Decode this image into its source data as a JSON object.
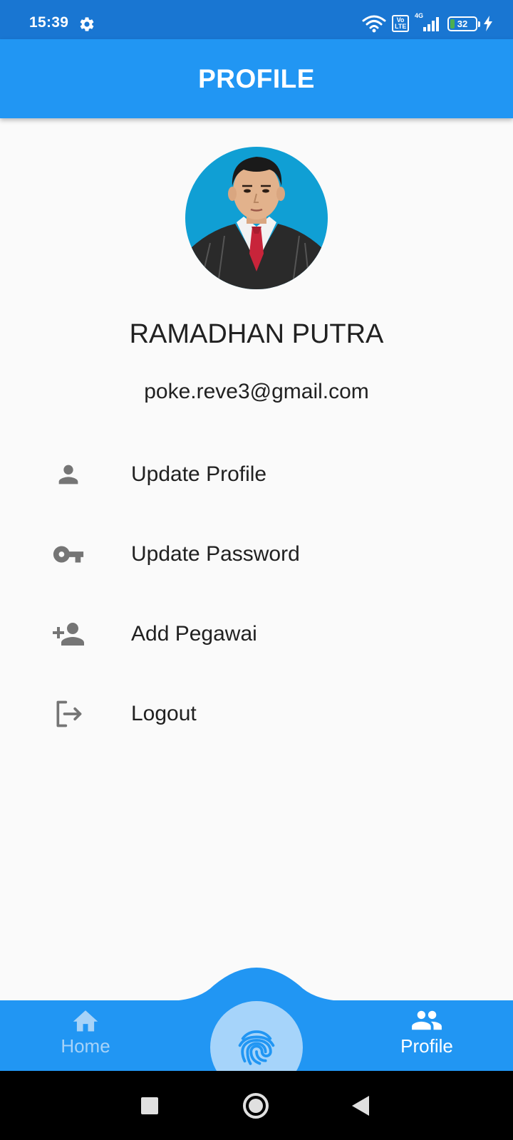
{
  "status_bar": {
    "time": "15:39",
    "network": "4G",
    "volte_top": "Vo",
    "volte_bottom": "LTE",
    "battery_level": "32",
    "icons": [
      "gear-icon",
      "wifi-icon",
      "volte-icon",
      "signal-icon",
      "battery-icon",
      "charging-icon"
    ]
  },
  "app_bar": {
    "title": "PROFILE"
  },
  "profile": {
    "name": "RAMADHAN PUTRA",
    "email": "poke.reve3@gmail.com"
  },
  "menu": {
    "items": [
      {
        "label": "Update Profile",
        "icon": "person-icon"
      },
      {
        "label": "Update Password",
        "icon": "key-icon"
      },
      {
        "label": "Add Pegawai",
        "icon": "add-person-icon"
      },
      {
        "label": "Logout",
        "icon": "logout-icon"
      }
    ]
  },
  "bottom_nav": {
    "home_label": "Home",
    "profile_label": "Profile",
    "active": "Profile",
    "fab_icon": "fingerprint-icon"
  },
  "colors": {
    "status_bar": "#1976d2",
    "primary": "#2196f3",
    "fab": "#a6d4fa",
    "icon_gray": "#757575",
    "text": "#212121",
    "inactive_nav": "#a7d3f8"
  }
}
